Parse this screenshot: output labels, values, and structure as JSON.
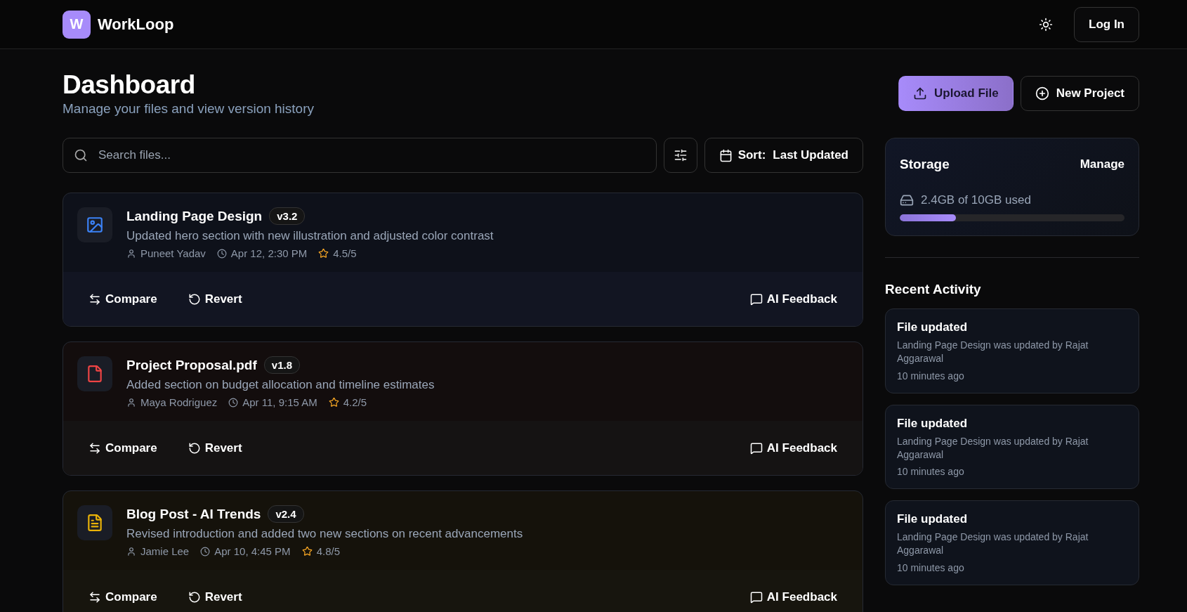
{
  "header": {
    "logo_letter": "W",
    "brand": "WorkLoop",
    "login": "Log In"
  },
  "page": {
    "title": "Dashboard",
    "subtitle": "Manage your files and view version history",
    "actions": [
      {
        "kind": "upload",
        "label": "Upload File"
      },
      {
        "kind": "new",
        "label": "New Project"
      }
    ]
  },
  "search": {
    "placeholder": "Search files..."
  },
  "sort": {
    "label": "Sort:",
    "value": "Last Updated"
  },
  "files": [
    {
      "kind": "image",
      "name": "Landing Page Design",
      "version": "v3.2",
      "description": "Updated hero section with new illustration and adjusted color contrast",
      "author": "Puneet Yadav",
      "date": "Apr 12, 2:30 PM",
      "rating": "4.5/5",
      "actions": [
        "Compare",
        "Revert",
        "AI Feedback"
      ]
    },
    {
      "kind": "pdf",
      "name": "Project Proposal.pdf",
      "version": "v1.8",
      "description": "Added section on budget allocation and timeline estimates",
      "author": "Maya Rodriguez",
      "date": "Apr 11, 9:15 AM",
      "rating": "4.2/5",
      "actions": [
        "Compare",
        "Revert",
        "AI Feedback"
      ]
    },
    {
      "kind": "document",
      "name": "Blog Post - AI Trends",
      "version": "v2.4",
      "description": "Revised introduction and added two new sections on recent advancements",
      "author": "Jamie Lee",
      "date": "Apr 10, 4:45 PM",
      "rating": "4.8/5",
      "actions": [
        "Compare",
        "Revert",
        "AI Feedback"
      ]
    }
  ],
  "storage": {
    "title": "Storage",
    "manage": "Manage",
    "usage": "2.4GB of 10GB used",
    "level": 0.25
  },
  "recent_activity": {
    "title": "Recent Activity",
    "items": [
      {
        "title": "File updated",
        "text": "Landing Page Design was updated by Rajat Aggarawal",
        "time": "10 minutes ago"
      },
      {
        "title": "File updated",
        "text": "Landing Page Design was updated by Rajat Aggarawal",
        "time": "10 minutes ago"
      },
      {
        "title": "File updated",
        "text": "Landing Page Design was updated by Rajat Aggarawal",
        "time": "10 minutes ago"
      }
    ]
  }
}
